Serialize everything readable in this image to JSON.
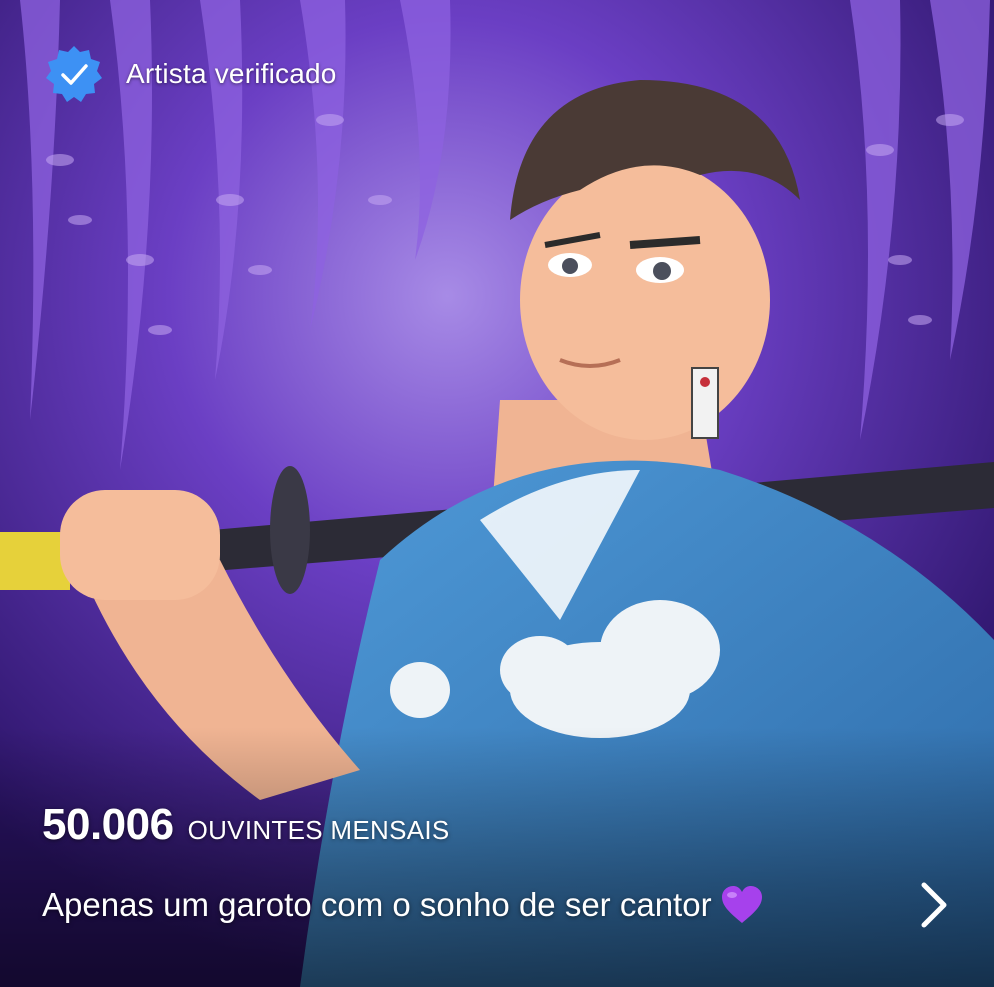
{
  "header": {
    "verified_label": "Artista verificado"
  },
  "stats": {
    "monthly_listeners": "50.006",
    "monthly_listeners_label": "OUVINTES MENSAIS"
  },
  "bio": {
    "text": "Apenas um garoto com o sonho de ser cantor"
  },
  "icons": {
    "verified": "verified-badge-icon",
    "bio_emoji": "purple-heart-icon",
    "more": "chevron-right-icon"
  },
  "colors": {
    "verified_badge": "#3d91f4",
    "background_purple": "#5b2fa8",
    "kimono_blue": "#3f86c8",
    "heart": "#a641ec",
    "text": "#ffffff"
  }
}
